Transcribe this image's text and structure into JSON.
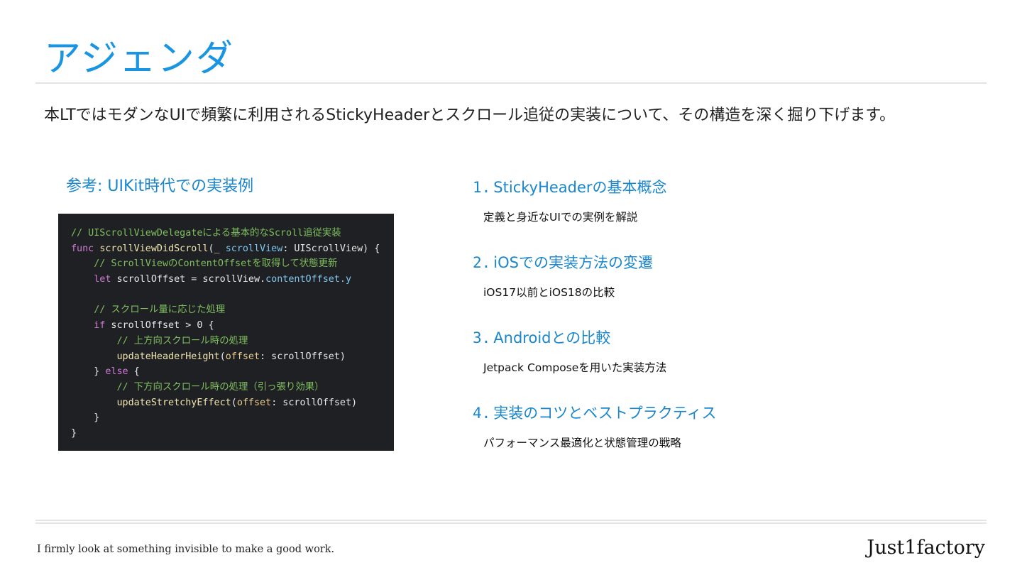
{
  "slide": {
    "title": "アジェンダ",
    "intro": "本LTではモダンなUIで頻繁に利用されるStickyHeaderとスクロール追従の実装について、その構造を深く掘り下げます。"
  },
  "reference": {
    "title": "参考: UIKit時代での実装例",
    "code_lines": [
      "// UIScrollViewDelegateによる基本的なScroll追従実装",
      "func scrollViewDidScroll(_ scrollView: UIScrollView) {",
      "    // ScrollViewのContentOffsetを取得して状態更新",
      "    let scrollOffset = scrollView.contentOffset.y",
      "",
      "    // スクロール量に応じた処理",
      "    if scrollOffset > 0 {",
      "        // 上方向スクロール時の処理",
      "        updateHeaderHeight(offset: scrollOffset)",
      "    } else {",
      "        // 下方向スクロール時の処理（引っ張り効果）",
      "        updateStretchyEffect(offset: scrollOffset)",
      "    }",
      "}"
    ]
  },
  "agenda": {
    "items": [
      {
        "num": "1.",
        "title": "StickyHeaderの基本概念",
        "desc": "定義と身近なUIでの実例を解説"
      },
      {
        "num": "2.",
        "title": "iOSでの実装方法の変遷",
        "desc": "iOS17以前とiOS18の比較"
      },
      {
        "num": "3.",
        "title": "Androidとの比較",
        "desc": "Jetpack Composeを用いた実装方法"
      },
      {
        "num": "4.",
        "title": "実装のコツとベストプラクティス",
        "desc": "パフォーマンス最適化と状態管理の戦略"
      }
    ]
  },
  "footer": {
    "tagline": "I firmly look at something invisible to make a good work.",
    "brand": "Just1factory"
  },
  "colors": {
    "accent": "#1a95e3",
    "code_bg": "#1f2023",
    "comment": "#7fbf5f",
    "keyword": "#d07ad8"
  }
}
